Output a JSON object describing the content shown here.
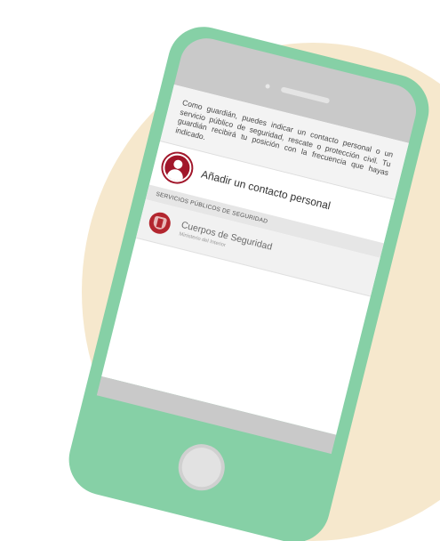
{
  "app": {
    "intro_text": "Como guardián, puedes indicar un contacto personal o un servicio público de seguridad, rescate o protección civil. Tu guardián recibirá tu posición con la frecuencia que hayas indicado."
  },
  "add_contact": {
    "label": "Añadir un contacto personal",
    "icon": "person-icon"
  },
  "section": {
    "title": "SERVICIOS PÚBLICOS DE SEGURIDAD"
  },
  "services": [
    {
      "title": "Cuerpos de Seguridad",
      "subtitle": "Ministerio del Interior",
      "icon": "security-emblem-icon"
    }
  ],
  "colors": {
    "background_circle": "#f6e8cd",
    "phone_body": "#86d0a6",
    "accent_red": "#a1162a"
  }
}
